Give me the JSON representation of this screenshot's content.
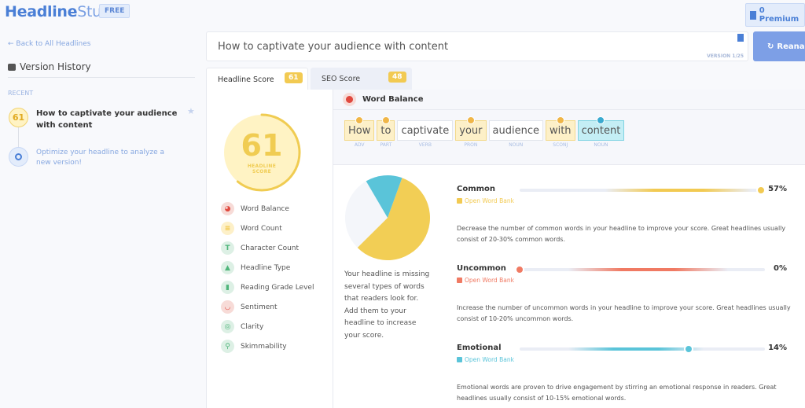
{
  "app": {
    "logo_bold": "Headline",
    "logo_light": "Studio",
    "plan_badge": "FREE",
    "premium_label": "0 Premium"
  },
  "sidebar": {
    "back_link": "← Back to All Headlines",
    "version_history": "Version History",
    "recent_label": "RECENT",
    "recent_items": [
      {
        "score": "61",
        "title": "How to captivate your audience with content"
      }
    ],
    "optimize_hint": "Optimize your headline to analyze a new version!"
  },
  "headline": {
    "value": "How to captivate your audience with content",
    "version": "VERSION 1/25",
    "reanalyze_label": "Reanaly"
  },
  "tabs": [
    {
      "label": "Headline Score",
      "score": "61"
    },
    {
      "label": "SEO Score",
      "score": "48"
    }
  ],
  "score": {
    "value": 61,
    "display": "61",
    "label_line1": "HEADLINE",
    "label_line2": "SCORE"
  },
  "categories": [
    {
      "label": "Word Balance",
      "icon": "pie-chart-icon",
      "color": "#e0493f",
      "bg": "#f7dbd7"
    },
    {
      "label": "Word Count",
      "icon": "lines-icon",
      "color": "#f0c23a",
      "bg": "#fdf0c8"
    },
    {
      "label": "Character Count",
      "icon": "letter-t-icon",
      "color": "#4fb57a",
      "bg": "#ddf0e5"
    },
    {
      "label": "Headline Type",
      "icon": "shapes-icon",
      "color": "#4fb57a",
      "bg": "#ddf0e5"
    },
    {
      "label": "Reading Grade Level",
      "icon": "book-icon",
      "color": "#4fb57a",
      "bg": "#ddf0e5"
    },
    {
      "label": "Sentiment",
      "icon": "smile-icon",
      "color": "#e0493f",
      "bg": "#f7dbd7"
    },
    {
      "label": "Clarity",
      "icon": "target-icon",
      "color": "#4fb57a",
      "bg": "#ddf0e5"
    },
    {
      "label": "Skimmability",
      "icon": "search-icon",
      "color": "#4fb57a",
      "bg": "#ddf0e5"
    }
  ],
  "word_balance": {
    "title": "Word Balance",
    "words": [
      {
        "text": "How",
        "pos": "ADV",
        "type": "common"
      },
      {
        "text": "to",
        "pos": "PART",
        "type": "common"
      },
      {
        "text": "captivate",
        "pos": "VERB",
        "type": "none"
      },
      {
        "text": "your",
        "pos": "PRON",
        "type": "common"
      },
      {
        "text": "audience",
        "pos": "NOUN",
        "type": "none"
      },
      {
        "text": "with",
        "pos": "SCONJ",
        "type": "common"
      },
      {
        "text": "content",
        "pos": "NOUN",
        "type": "emotional"
      }
    ],
    "summary": "Your headline is missing several types of words that readers look for. Add them to your headline to increase your score.",
    "metrics": [
      {
        "name": "Common",
        "percent": 57,
        "percent_label": "57%",
        "bank_label": "Open Word Bank",
        "color": "#f2ca52",
        "description": "Decrease the number of common words in your headline to improve your score. Great headlines usually consist of 20-30% common words."
      },
      {
        "name": "Uncommon",
        "percent": 0,
        "percent_label": "0%",
        "bank_label": "Open Word Bank",
        "color": "#f07a63",
        "description": "Increase the number of uncommon words in your headline to improve your score. Great headlines usually consist of 10-20% uncommon words."
      },
      {
        "name": "Emotional",
        "percent": 14,
        "percent_label": "14%",
        "bank_label": "Open Word Bank",
        "color": "#5ac4d9",
        "description": "Emotional words are proven to drive engagement by stirring an emotional response in readers. Great headlines usually consist of 10-15% emotional words."
      }
    ]
  },
  "chart_data": {
    "type": "pie",
    "title": "Word Balance",
    "slices": [
      {
        "label": "Common",
        "value": 57,
        "color": "#f2ce55"
      },
      {
        "label": "Other",
        "value": 29,
        "color": "#f4f6fa"
      },
      {
        "label": "Emotional",
        "value": 14,
        "color": "#5ac4d9"
      }
    ]
  }
}
